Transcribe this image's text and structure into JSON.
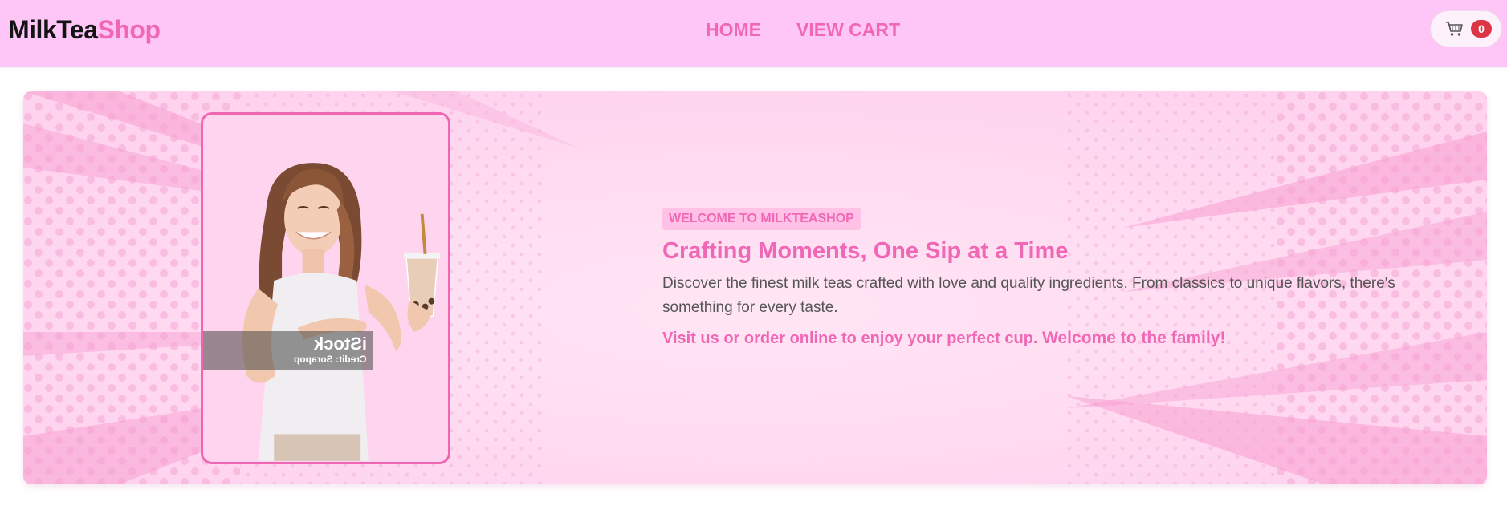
{
  "navbar": {
    "brand_part1": "MilkTea",
    "brand_part2": "Shop",
    "links": [
      {
        "label": "HOME"
      },
      {
        "label": "VIEW CART"
      }
    ],
    "cart": {
      "icon": "cart-icon",
      "count": "0"
    }
  },
  "hero": {
    "badge": "WELCOME TO MILKTEASHOP",
    "title": "Crafting Moments, One Sip at a Time",
    "description": "Discover the finest milk teas crafted with love and quality ingredients. From classics to unique flavors, there's something for every taste.",
    "cta_text": "Visit us or order online to enjoy your perfect cup.",
    "cta_strong": "Welcome to the family!",
    "image": {
      "watermark_logo": "iStock",
      "watermark_credit": "Credit: Sorapop"
    }
  },
  "colors": {
    "navbar_bg": "#fec5f7",
    "accent_pink": "#f067b6",
    "badge_red": "#dc3545",
    "hero_bg": "#ffdaf1"
  }
}
